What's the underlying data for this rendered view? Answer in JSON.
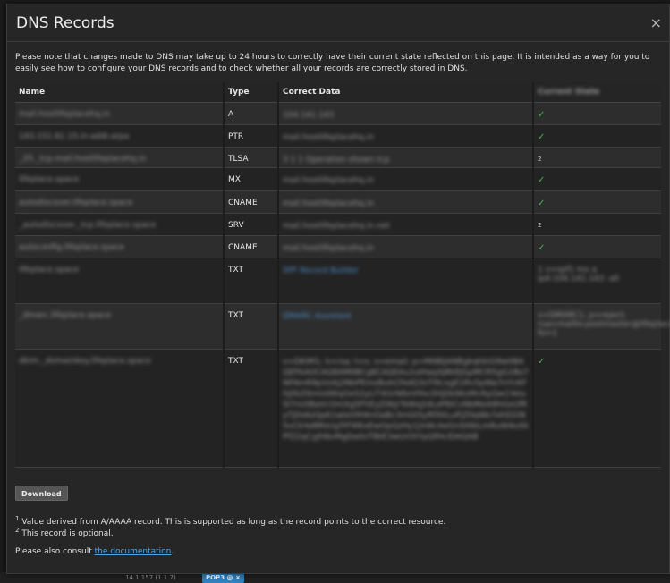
{
  "background": {
    "badge": "POP3 @ ×",
    "snippet": "14.1.157 (1.1 7)"
  },
  "modal": {
    "title": "DNS Records",
    "close": "×",
    "intro": "Please note that changes made to DNS may take up to 24 hours to correctly have their current state reflected on this page. It is intended as a way for you to easily see how to configure your DNS records and to check whether all your records are correctly stored in DNS.",
    "columns": {
      "name": "Name",
      "type": "Type",
      "data": "Correct Data",
      "status": "Current State"
    },
    "rows": [
      {
        "name": "mail.hostlifeplacehq.in",
        "type": "A",
        "data": "104.141.143",
        "status": "✓"
      },
      {
        "name": "143.151.61.15.in-addr.arpa",
        "type": "PTR",
        "data": "mail.hostlifeplacehq.in",
        "status": "✓"
      },
      {
        "name": "_25._tcp.mail.hostlifeplacehq.in",
        "type": "TLSA",
        "data": "3 1 1 Operation shown tcp",
        "status": "2"
      },
      {
        "name": "lifeplace.space",
        "type": "MX",
        "data": "mail.hostlifeplacehq.in",
        "status": "✓"
      },
      {
        "name": "autodiscover.lifeplace.space",
        "type": "CNAME",
        "data": "mail.hostlifeplacehq.in",
        "status": "✓"
      },
      {
        "name": "_autodiscover._tcp.lifeplace.space",
        "type": "SRV",
        "data": "mail.hostlifeplacehq.in.net",
        "status": "2"
      },
      {
        "name": "autoconfig.lifeplace.space",
        "type": "CNAME",
        "data": "mail.hostlifeplacehq.in",
        "status": "✓"
      },
      {
        "name": "lifeplace.space",
        "type": "TXT",
        "data": "SPF Record Builder",
        "status": "1 v=spf1 mx a ip4:104.141.143 -all"
      },
      {
        "name": "_dmarc.lifeplace.space",
        "type": "TXT",
        "data": "DMARC Assistant",
        "status": "v=DMARC1; p=reject; rua=mailto:postmaster@lifeplace.space; fo=1"
      },
      {
        "name": "dkim._domainkey.lifeplace.space",
        "type": "TXT",
        "data": "v=DKIM1; k=rsa; t=s; s=email; p=MIIBIjANBgkqhkiG9w0BAQEFAAOCAQ8AMIIBCgKCAQEAu1sIHaqXJ8kEJGpMCR5gG1Bo7Wf4mR8pVzAj2NbPEmzBuhLTAdQ3sTl9cxgE1Rv5pWa7nYcKFhJ0bZ6mUdWqOeS2yLiT4GrN8xVfAo3HjDb9KzMcRpQw1YeIuSl7nUtBaVcOmXg5FhEyZ0kJrTsWq2dLoP8iCvNbMeA9hGxUfRyTjDs6zQpK1wIeVlH4nOaBc3mGtSyRfXkLuPjZ0qWo7ehD2iN5vCbYa8MsUgTrF9lKxEwOpQzHy1jVdIcAeGnSt6bLmRuW4oXkPfZ2qCyJhNvMgDa0sTlBiE3wUrOtYpQfHcIDAQAB",
        "status": "✓"
      }
    ],
    "download_label": "Download",
    "footnote1": "Value derived from A/AAAA record. This is supported as long as the record points to the correct resource.",
    "footnote2": "This record is optional.",
    "consult_prefix": "Please also consult ",
    "consult_link": "the documentation",
    "consult_suffix": "."
  }
}
